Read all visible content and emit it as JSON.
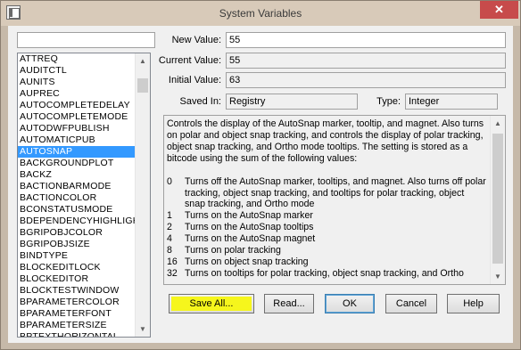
{
  "window": {
    "title": "System Variables",
    "close_glyph": "✕"
  },
  "search": {
    "value": ""
  },
  "variables": [
    "ATTREQ",
    "AUDITCTL",
    "AUNITS",
    "AUPREC",
    "AUTOCOMPLETEDELAY",
    "AUTOCOMPLETEMODE",
    "AUTODWFPUBLISH",
    "AUTOMATICPUB",
    "AUTOSNAP",
    "BACKGROUNDPLOT",
    "BACKZ",
    "BACTIONBARMODE",
    "BACTIONCOLOR",
    "BCONSTATUSMODE",
    "BDEPENDENCYHIGHLIGHT",
    "BGRIPOBJCOLOR",
    "BGRIPOBJSIZE",
    "BINDTYPE",
    "BLOCKEDITLOCK",
    "BLOCKEDITOR",
    "BLOCKTESTWINDOW",
    "BPARAMETERCOLOR",
    "BPARAMETERFONT",
    "BPARAMETERSIZE",
    "BPTEXTHORIZONTAL"
  ],
  "selected_variable": "AUTOSNAP",
  "fields": {
    "new_value_label": "New Value:",
    "new_value": "55",
    "current_value_label": "Current Value:",
    "current_value": "55",
    "initial_value_label": "Initial Value:",
    "initial_value": "63",
    "saved_in_label": "Saved In:",
    "saved_in": "Registry",
    "type_label": "Type:",
    "type": "Integer"
  },
  "description": {
    "intro": "Controls the display of the AutoSnap marker, tooltip, and magnet. Also turns on polar and object snap tracking, and controls the display of polar tracking, object snap tracking, and Ortho mode tooltips. The setting is stored as a bitcode using the sum of the following values:",
    "options": [
      {
        "num": "0",
        "text": "Turns off the AutoSnap marker, tooltips, and magnet. Also turns off polar tracking, object snap tracking, and tooltips for polar tracking, object snap tracking, and Ortho mode"
      },
      {
        "num": "1",
        "text": "Turns on the AutoSnap marker"
      },
      {
        "num": "2",
        "text": "Turns on the AutoSnap tooltips"
      },
      {
        "num": "4",
        "text": "Turns on the AutoSnap magnet"
      },
      {
        "num": "8",
        "text": "Turns on polar tracking"
      },
      {
        "num": "16",
        "text": "Turns on object snap tracking"
      },
      {
        "num": "32",
        "text": "Turns on tooltips for polar tracking, object snap tracking, and Ortho"
      }
    ]
  },
  "buttons": {
    "save_all": "Save All...",
    "read": "Read...",
    "ok": "OK",
    "cancel": "Cancel",
    "help": "Help"
  },
  "colors": {
    "selection": "#3399ff",
    "highlight": "#f6f61c",
    "close_button": "#c74b4b",
    "frame": "#c6b9a9"
  }
}
